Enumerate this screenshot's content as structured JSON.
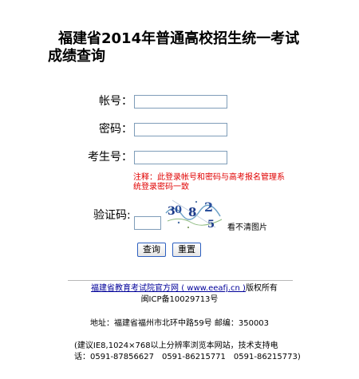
{
  "header": {
    "title": "福建省2014年普通高校招生统一考试成绩查询"
  },
  "form": {
    "account_label": "帐号：",
    "account_value": "",
    "password_label": "密码：",
    "password_value": "",
    "examno_label": "考生号：",
    "examno_value": "",
    "notice": "注释：此登录帐号和密码与高考报名管理系统登录密码一致",
    "captcha_label": "验证码:",
    "captcha_value": "",
    "captcha_text": "30 8 2 5",
    "captcha_chars": [
      "3",
      "0",
      "8",
      "2",
      "5"
    ],
    "refresh_label": "看不清图片",
    "query_button": "查询",
    "reset_button": "重置"
  },
  "footer": {
    "link_text": "福建省教育考试院官方网 ( www.eeafj.cn )",
    "copyright": "版权所有",
    "icp": "闽ICP备10029713号",
    "address": "地址：福建省福州市北环中路59号 邮编：350003",
    "advice": "(建议IE8,1024×768以上分辨率浏览本网站，技术支持电",
    "phones": "话：0591-87856627　0591-86215771　0591-86215773)"
  },
  "colors": {
    "notice": "#e00000",
    "link": "#000099",
    "input_border": "#7f9db9",
    "button_border": "#2c5fbf"
  }
}
